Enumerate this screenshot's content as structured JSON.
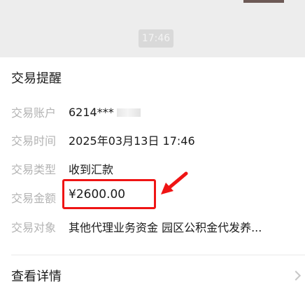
{
  "timestamp": "17:46",
  "card": {
    "title": "交易提醒",
    "rows": [
      {
        "label": "交易账户",
        "value": "6214***"
      },
      {
        "label": "交易时间",
        "value": "2025年03月13日 17:46"
      },
      {
        "label": "交易类型",
        "value": "收到汇款"
      },
      {
        "label": "交易金额",
        "value": "¥2600.00"
      },
      {
        "label": "交易对象",
        "value": "其他代理业务资金 园区公积金代发养..."
      }
    ],
    "details_label": "查看详情"
  },
  "colors": {
    "highlight": "#ef1414",
    "background": "#ededed"
  }
}
